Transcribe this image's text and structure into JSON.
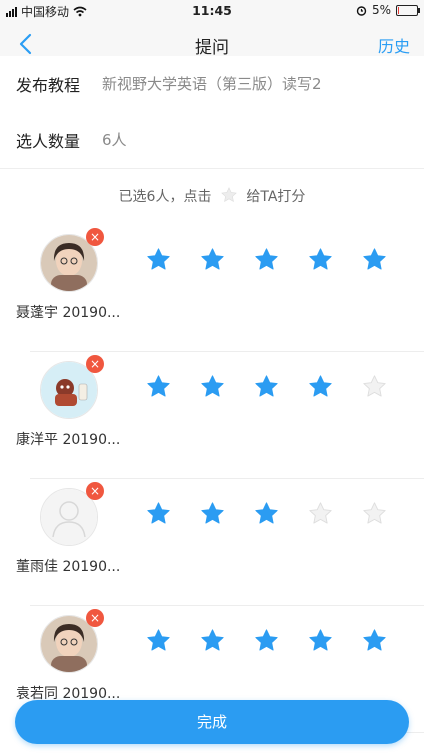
{
  "status_bar": {
    "carrier": "中国移动",
    "time": "11:45",
    "battery_text": "5%",
    "battery_level": 0.05,
    "icons": [
      "signal-icon",
      "wifi-icon",
      "alarm-icon",
      "battery-icon"
    ]
  },
  "nav": {
    "title": "提问",
    "history_label": "历史",
    "back_icon": "chevron-left-icon"
  },
  "course": {
    "label": "发布教程",
    "value": "新视野大学英语（第三版）读写2"
  },
  "selection": {
    "label": "选人数量",
    "value": "6人"
  },
  "hint": {
    "before": "已选6人，点击",
    "after": "给TA打分"
  },
  "colors": {
    "accent": "#2a9df4",
    "star_filled": "#2b9cf2",
    "star_empty": "#e6e6e6",
    "remove": "#f0573f"
  },
  "students": [
    {
      "name": "聂蓬宇 20190...",
      "rating": 5,
      "avatar": "photo-avatar"
    },
    {
      "name": "康洋平 20190...",
      "rating": 4,
      "avatar": "cartoon-avatar"
    },
    {
      "name": "董雨佳 20190...",
      "rating": 3,
      "avatar": "default-avatar"
    },
    {
      "name": "袁若同 20190...",
      "rating": 5,
      "avatar": "photo-avatar"
    }
  ],
  "done_label": "完成"
}
